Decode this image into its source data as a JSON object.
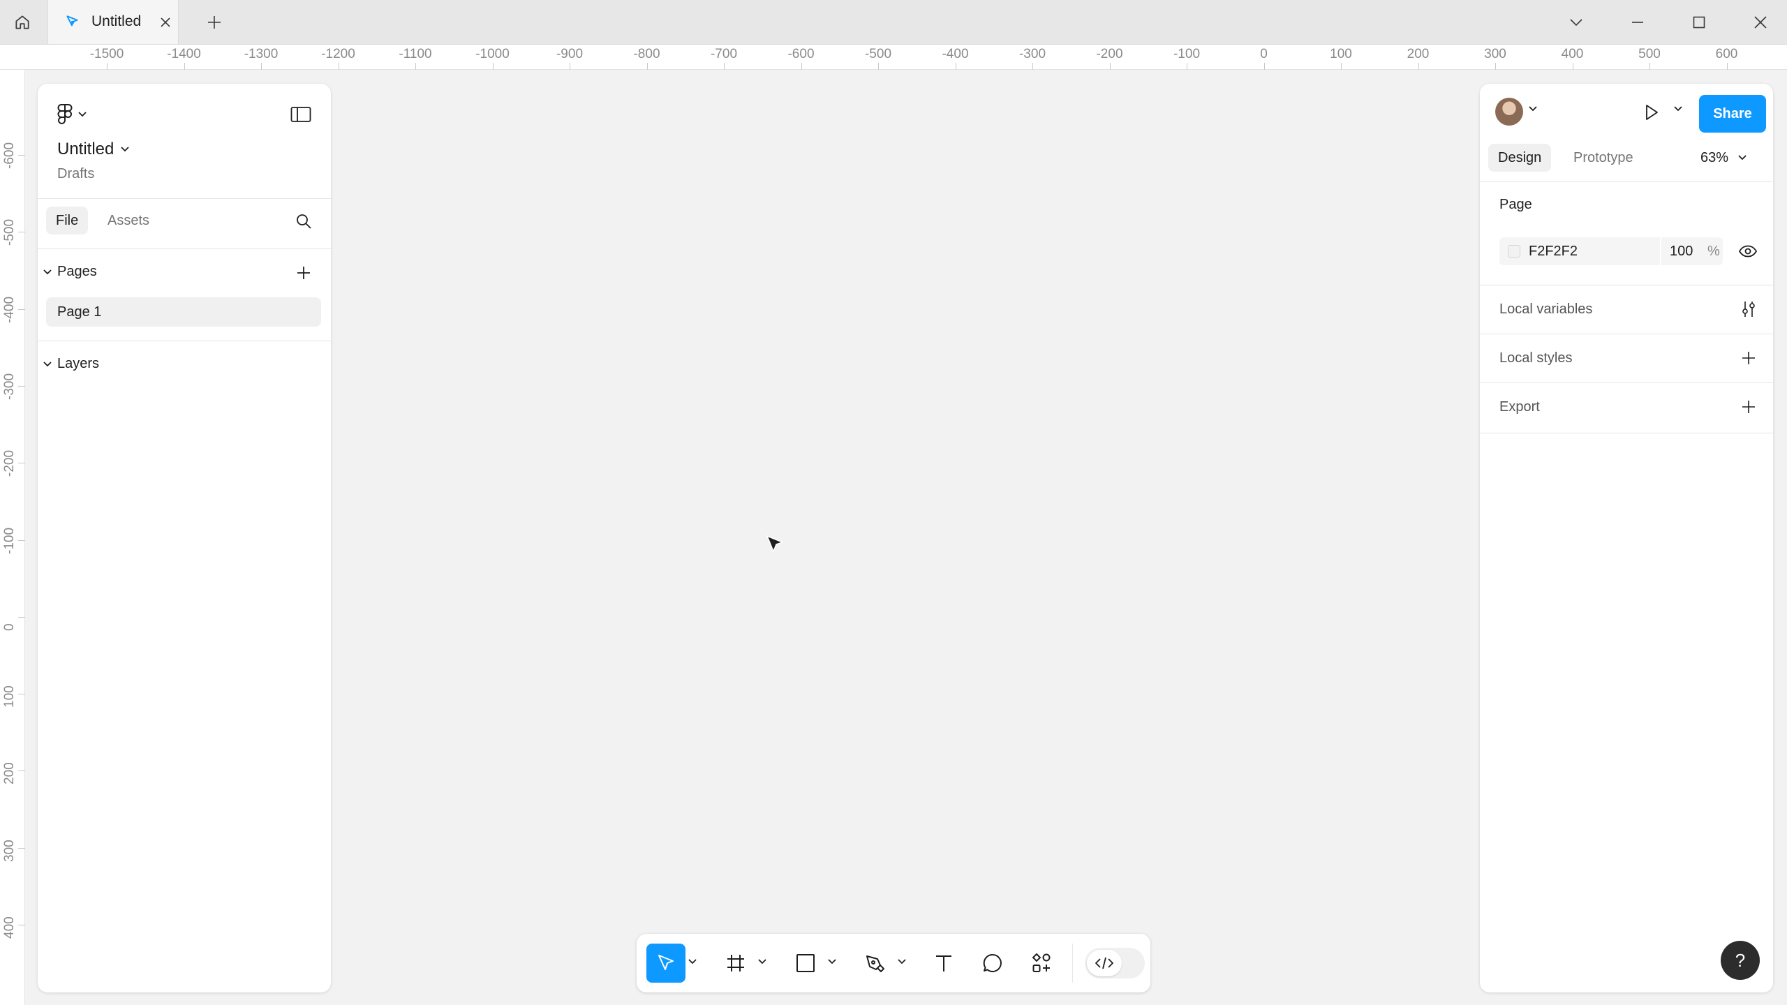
{
  "titlebar": {
    "tab_title": "Untitled"
  },
  "ruler": {
    "x_labels": [
      "-1500",
      "-1400",
      "-1300",
      "-1200",
      "-1100",
      "-1000",
      "-900",
      "-800",
      "-700",
      "-600",
      "-500",
      "-400",
      "-300",
      "-200",
      "-100",
      "0",
      "100",
      "200",
      "300",
      "400",
      "500",
      "600"
    ],
    "y_labels": [
      "-600",
      "-500",
      "-400",
      "-300",
      "-200",
      "-100",
      "0",
      "100",
      "200",
      "300",
      "400"
    ]
  },
  "left_panel": {
    "file_name": "Untitled",
    "location": "Drafts",
    "tabs": {
      "file": "File",
      "assets": "Assets"
    },
    "pages_label": "Pages",
    "pages": [
      "Page 1"
    ],
    "layers_label": "Layers"
  },
  "right_panel": {
    "share_label": "Share",
    "tabs": {
      "design": "Design",
      "prototype": "Prototype"
    },
    "zoom": "63%",
    "page_section_label": "Page",
    "background": {
      "hex": "F2F2F2",
      "opacity": "100",
      "unit": "%"
    },
    "rows": {
      "local_variables": "Local variables",
      "local_styles": "Local styles",
      "export": "Export"
    },
    "help_label": "?"
  },
  "colors": {
    "accent": "#0d99ff",
    "canvas": "#f2f2f2"
  }
}
